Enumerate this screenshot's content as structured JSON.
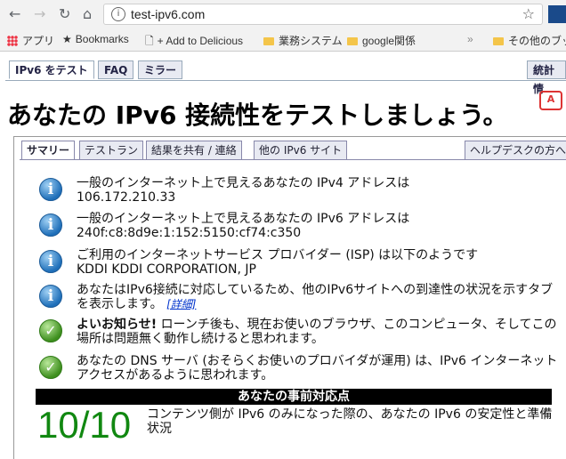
{
  "browser": {
    "back_icon": "back-arrow-icon",
    "forward_icon": "forward-arrow-icon",
    "reload_icon": "reload-icon",
    "home_icon": "home-icon",
    "url": "test-ipv6.com",
    "bookmarks": [
      {
        "label": "アプリ"
      },
      {
        "label": "Bookmarks"
      },
      {
        "label": "+ Add to Delicious"
      },
      {
        "label": "業務システム"
      },
      {
        "label": "google関係"
      },
      {
        "label": "その他のブック"
      }
    ]
  },
  "site": {
    "tabs": [
      "IPv6 をテスト",
      "FAQ",
      "ミラー",
      "統計情"
    ],
    "headline": "あなたの IPv6 接続性をテストしましょう。",
    "lang_icon_label": "A",
    "subtabs": [
      "サマリー",
      "テストラン",
      "結果を共有 / 連絡",
      "他の IPv6 サイト",
      "ヘルプデスクの方へ"
    ]
  },
  "results": [
    {
      "type": "info",
      "text": "一般のインターネット上で見えるあなたの IPv4 アドレスは",
      "value": "106.172.210.33"
    },
    {
      "type": "info",
      "text": "一般のインターネット上で見えるあなたの IPv6 アドレスは",
      "value": "240f:c8:8d9e:1:152:5150:cf74:c350"
    },
    {
      "type": "info",
      "text": "ご利用のインターネットサービス プロバイダー (ISP) は以下のようです",
      "value": "KDDI KDDI CORPORATION, JP"
    },
    {
      "type": "info",
      "text": "あなたはIPv6接続に対応しているため、他のIPv6サイトへの到達性の状況を示すタブを表示します。",
      "link": "[詳細]"
    },
    {
      "type": "ok",
      "bold": "よいお知らせ!",
      "text": "ローンチ後も、現在お使いのブラウザ、このコンピュータ、そしてこの場所は問題無く動作し続けると思われます。"
    },
    {
      "type": "ok",
      "text": "あなたの DNS サーバ (おそらくお使いのプロバイダが運用) は、IPv6 インターネットアクセスがあるように思われます。"
    }
  ],
  "score": {
    "heading": "あなたの事前対応点",
    "value": "10/10",
    "description": "コンテンツ側が IPv6 のみになった際の、あなたの IPv6 の安定性と準備状況"
  },
  "colors": {
    "score": "#118811",
    "info_icon": "#1f6fb9",
    "ok_icon": "#3e8f1e",
    "link": "#0033cc"
  }
}
